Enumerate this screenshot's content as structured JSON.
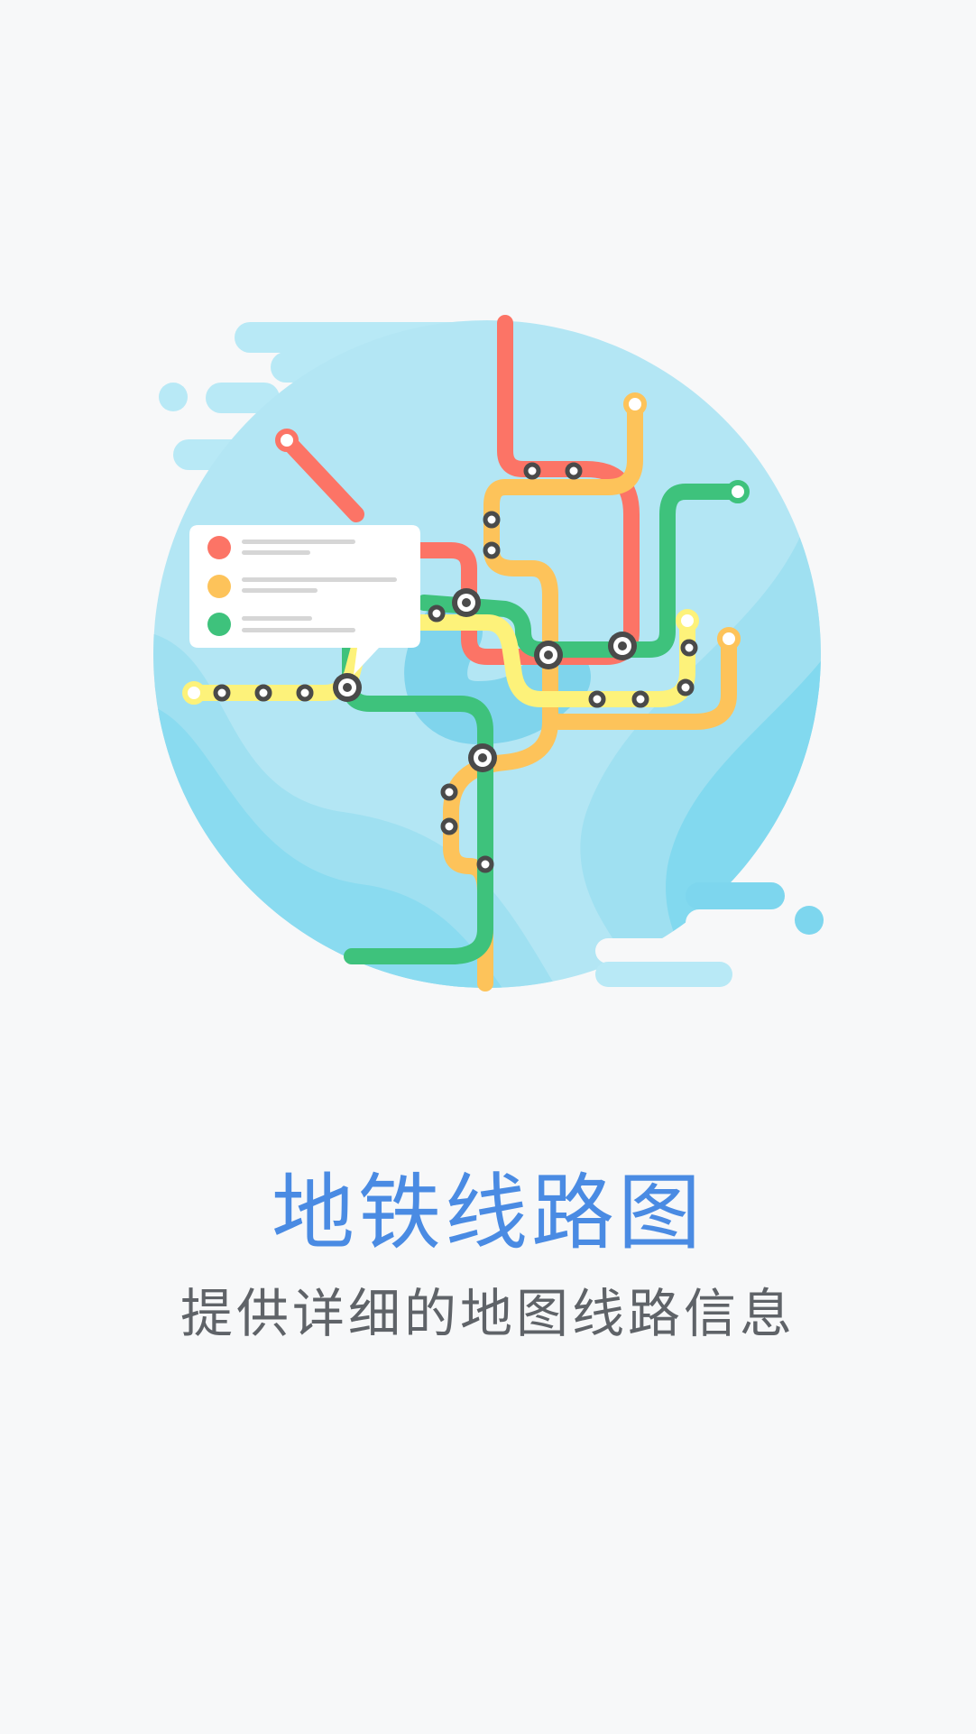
{
  "intro": {
    "title": "地铁线路图",
    "subtitle": "提供详细的地图线路信息"
  },
  "illustration": {
    "icon": "metro-map-illustration",
    "colors": {
      "background": "#f7f8f9",
      "globe": "#b3e6f4",
      "globe_dark": "#7dd6ee",
      "cloud": "#b8e9f6",
      "line_red": "#fc7466",
      "line_yellow": "#fdc35a",
      "line_green": "#3ec27c",
      "line_lightyellow": "#fdf27a",
      "station_ring": "#4a4a4a",
      "title_blue": "#4a8be3",
      "subtitle_gray": "#5f6368"
    }
  }
}
